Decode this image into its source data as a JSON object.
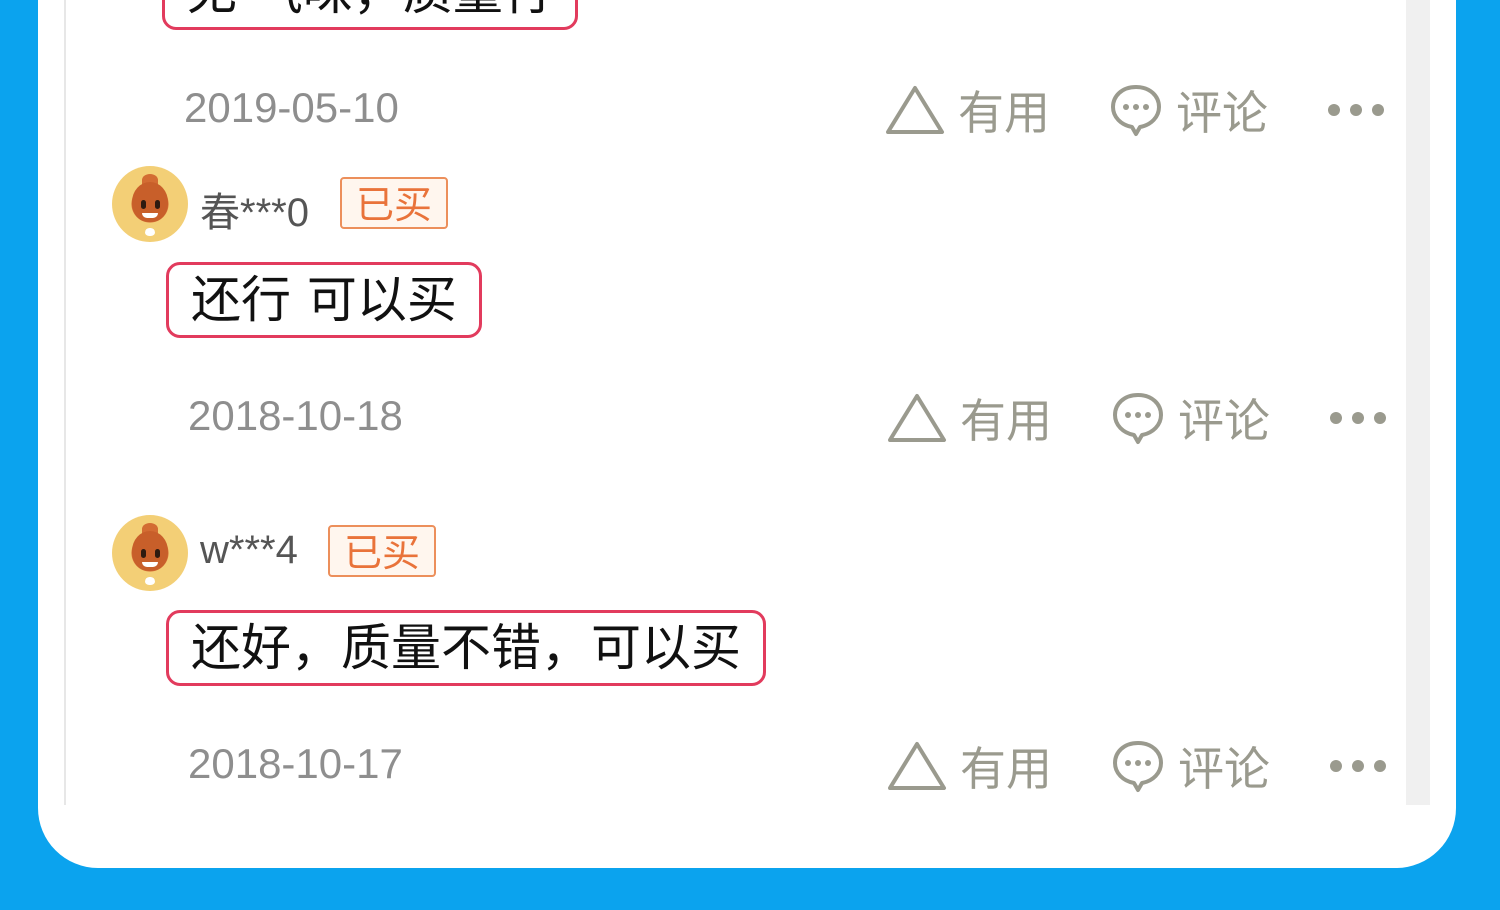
{
  "reviews": [
    {
      "partial": true,
      "comment": "无 气味，质量行",
      "date": "2019-05-10",
      "useful_label": "有用",
      "comment_action_label": "评论"
    },
    {
      "user": "春***0",
      "badge": "已买",
      "comment": "还行 可以买",
      "date": "2018-10-18",
      "useful_label": "有用",
      "comment_action_label": "评论"
    },
    {
      "user": "w***4",
      "badge": "已买",
      "comment": "还好，质量不错，可以买",
      "date": "2018-10-17",
      "useful_label": "有用",
      "comment_action_label": "评论"
    }
  ],
  "colors": {
    "background": "#0ba3ee",
    "highlight_border": "#e23b5d",
    "badge": "#e9733a",
    "muted_text": "#9a9a8e"
  },
  "icons": [
    "triangle-useful-icon",
    "speech-bubble-icon",
    "more-dots-icon",
    "avatar-icon"
  ]
}
